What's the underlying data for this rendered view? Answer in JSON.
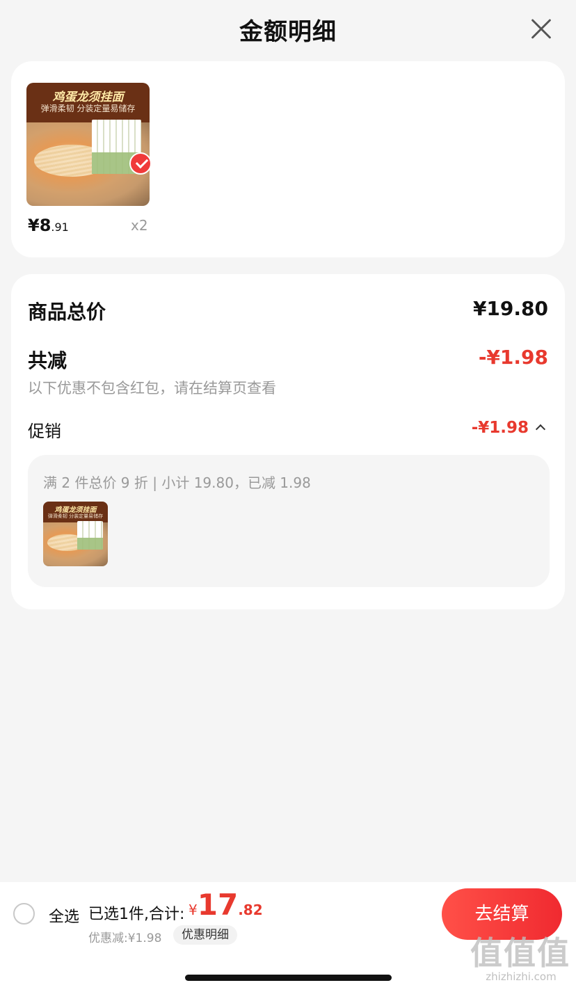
{
  "header": {
    "title": "金额明细",
    "close_icon": "close-icon"
  },
  "products": [
    {
      "image_title": "鸡蛋龙须挂面",
      "image_subtitle": "弹滑柔韧 分装定量易储存",
      "price_int": "¥8",
      "price_dec": ".91",
      "quantity": "x2",
      "selected": true
    }
  ],
  "summary": {
    "total_label": "商品总价",
    "total_value": "¥19.80",
    "reduction_label": "共减",
    "reduction_value": "-¥1.98",
    "note": "以下优惠不包含红包，请在结算页查看",
    "promo_label": "促销",
    "promo_value": "-¥1.98",
    "promo_desc": "满 2 件总价 9 折 | 小计 19.80，已减 1.98"
  },
  "bottom_bar": {
    "select_all": "全选",
    "selected_text": "已选1件,合计:",
    "total_currency": "¥",
    "total_int": "17",
    "total_dec": ".82",
    "discount_text": "优惠减:¥1.98",
    "discount_detail": "优惠明细",
    "checkout": "去结算"
  },
  "watermark": {
    "glyphs": [
      "值",
      "值",
      "值"
    ],
    "url": "zhizhizhi.com"
  },
  "colors": {
    "accent_red": "#e8392e",
    "checkout_start": "#ff5048",
    "checkout_end": "#f02a30",
    "background": "#f5f5f5"
  }
}
